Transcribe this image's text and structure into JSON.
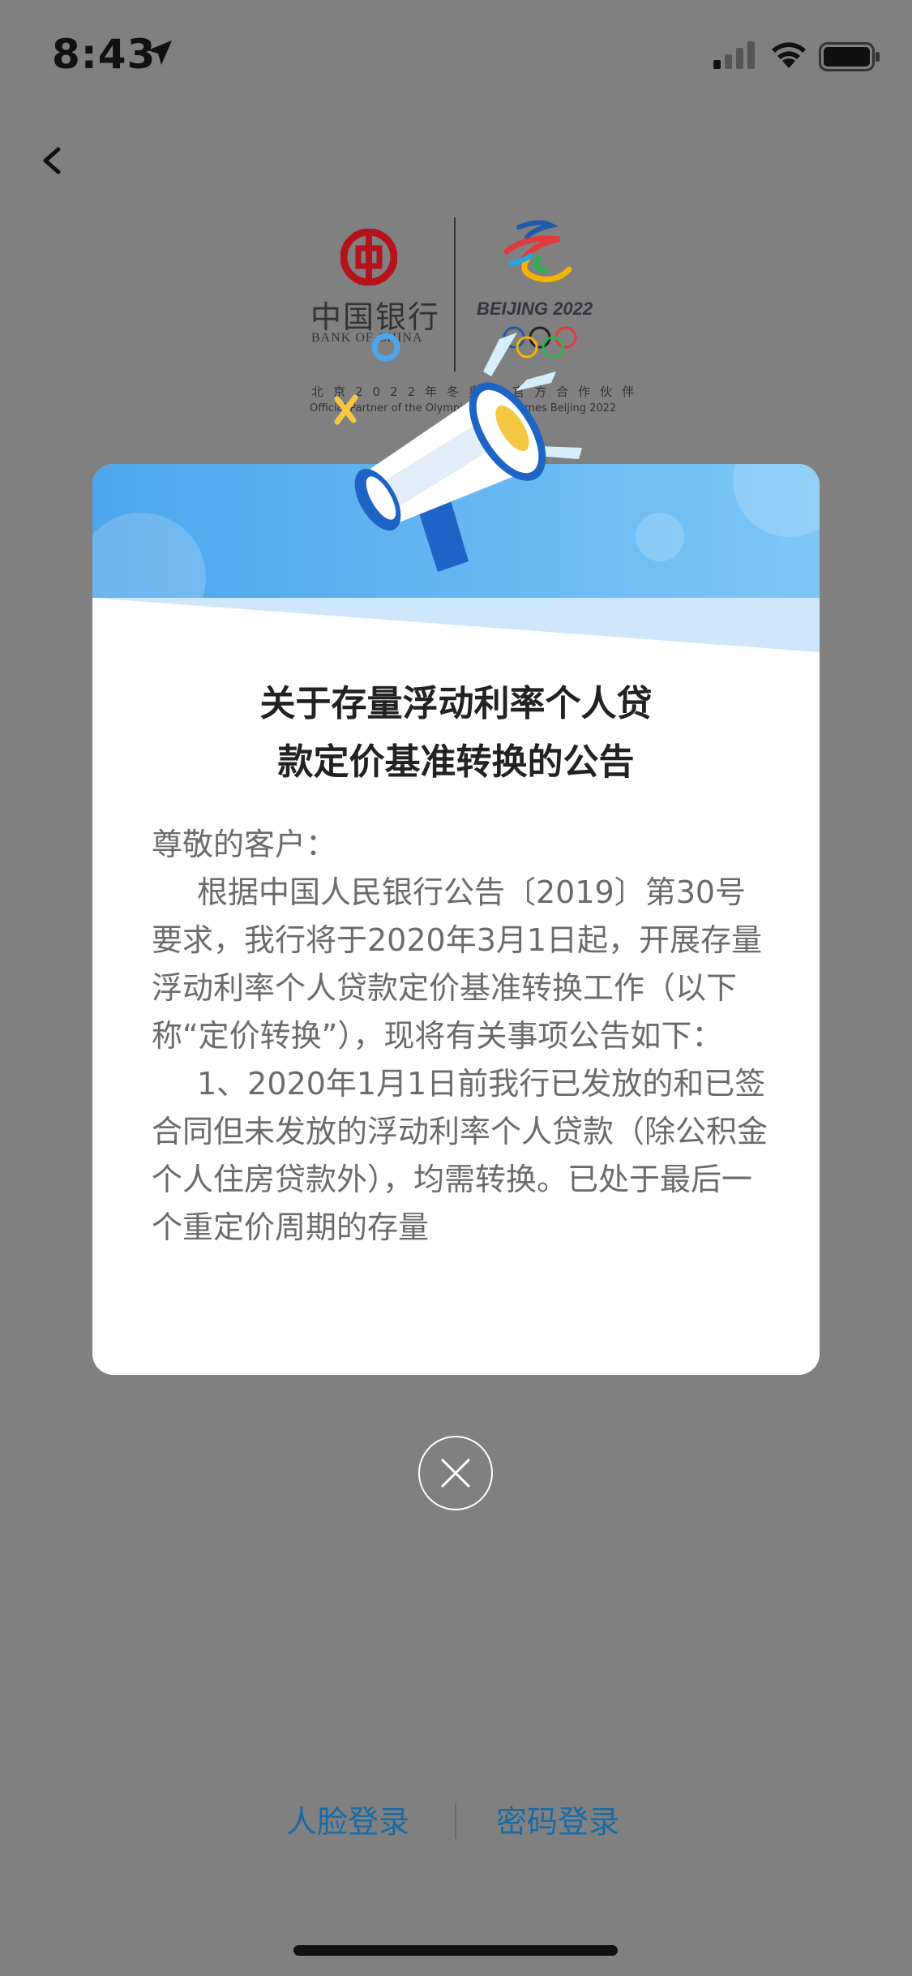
{
  "status_bar": {
    "time": "8:43"
  },
  "logos": {
    "bank_name_cn": "中国银行",
    "bank_name_en": "BANK OF CHINA",
    "olympics_text": "BEIJING 2022",
    "partner_cn": "北京2022年冬奥会官方合作伙伴",
    "partner_en": "Official Partner of the Olympic Winter Games Beijing 2022"
  },
  "notice": {
    "title_line1": "关于存量浮动利率个人贷",
    "title_line2": "款定价基准转换的公告",
    "greeting": "尊敬的客户：",
    "paragraph1": "根据中国人民银行公告〔2019〕第30号要求，我行将于2020年3月1日起，开展存量浮动利率个人贷款定价基准转换工作（以下称“定价转换”），现将有关事项公告如下：",
    "paragraph2": "1、2020年1月1日前我行已发放的和已签合同但未发放的浮动利率个人贷款（除公积金个人住房贷款外），均需转换。已处于最后一个重定价周期的存量"
  },
  "login": {
    "face_login": "人脸登录",
    "password_login": "密码登录"
  },
  "colors": {
    "overlay": "#808080",
    "header_blue": "#5aaef0",
    "link_blue": "#1a6aa5"
  }
}
